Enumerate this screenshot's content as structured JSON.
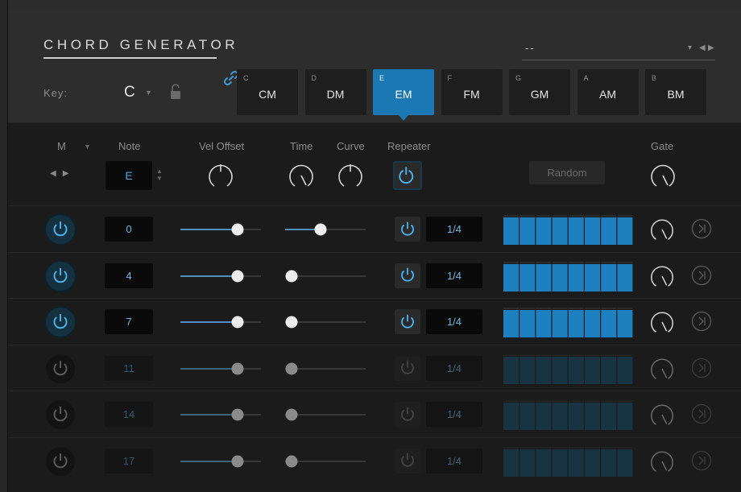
{
  "header": {
    "title": "CHORD GENERATOR",
    "preset": {
      "value": "--"
    },
    "key": {
      "label": "Key:",
      "value": "C"
    },
    "chords": [
      {
        "note": "C",
        "chord": "CM",
        "active": false
      },
      {
        "note": "D",
        "chord": "DM",
        "active": false
      },
      {
        "note": "E",
        "chord": "EM",
        "active": true
      },
      {
        "note": "F",
        "chord": "FM",
        "active": false
      },
      {
        "note": "G",
        "chord": "GM",
        "active": false
      },
      {
        "note": "A",
        "chord": "AM",
        "active": false
      },
      {
        "note": "B",
        "chord": "BM",
        "active": false
      }
    ]
  },
  "columns": {
    "mode": "M",
    "note": "Note",
    "vel_offset": "Vel Offset",
    "time": "Time",
    "curve": "Curve",
    "repeater": "Repeater",
    "gate": "Gate"
  },
  "controls": {
    "root_note": "E",
    "random_label": "Random"
  },
  "colors": {
    "accent": "#1c78b2",
    "accent_light": "#4aa8e0",
    "step_on": "#1f80bf",
    "step_off": "#183341"
  },
  "rows": [
    {
      "enabled": true,
      "note": "0",
      "vel": 0.71,
      "time": 0.44,
      "rate": "1/4",
      "steps": 8
    },
    {
      "enabled": true,
      "note": "4",
      "vel": 0.71,
      "time": 0.08,
      "rate": "1/4",
      "steps": 8
    },
    {
      "enabled": true,
      "note": "7",
      "vel": 0.71,
      "time": 0.08,
      "rate": "1/4",
      "steps": 8
    },
    {
      "enabled": false,
      "note": "11",
      "vel": 0.71,
      "time": 0.08,
      "rate": "1/4",
      "steps": 8
    },
    {
      "enabled": false,
      "note": "14",
      "vel": 0.71,
      "time": 0.08,
      "rate": "1/4",
      "steps": 8
    },
    {
      "enabled": false,
      "note": "17",
      "vel": 0.71,
      "time": 0.08,
      "rate": "1/4",
      "steps": 8
    }
  ]
}
